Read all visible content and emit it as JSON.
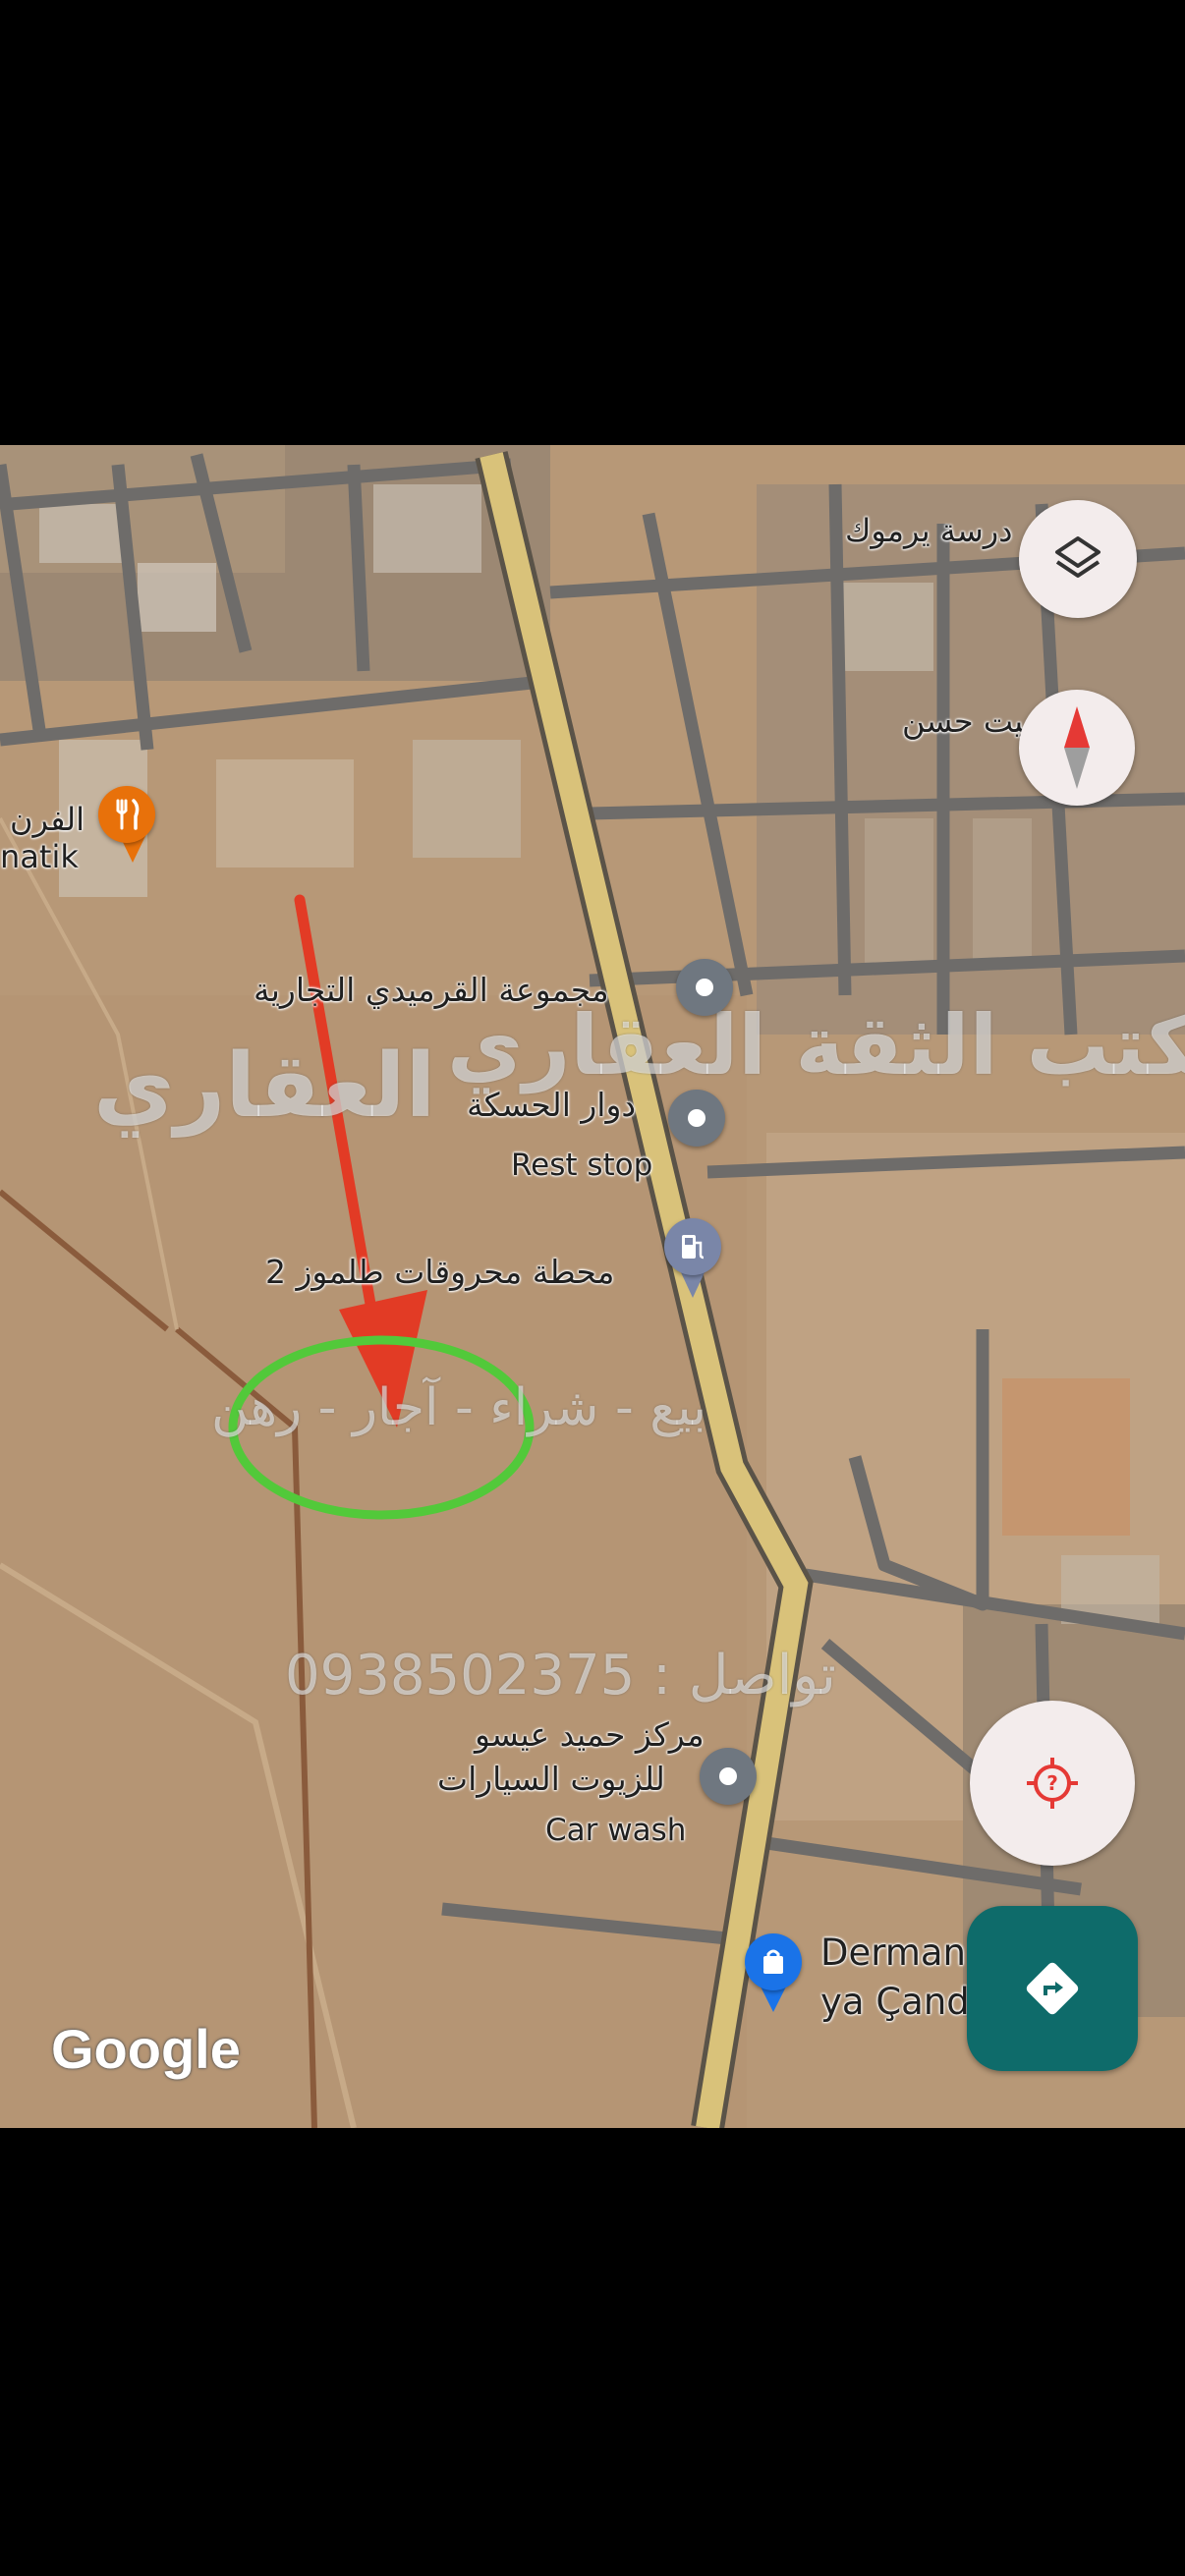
{
  "map": {
    "labels": {
      "school": "درسة يرموك",
      "hassan": "بيت حسن",
      "bakery_ar": "الفرن",
      "bakery_lat": "natik",
      "qarmidi": "مجموعة القرميدي التجارية",
      "hasaka_roundabout": "دوار الحسكة",
      "rest_stop": "Rest stop",
      "fuel_station": "محطة محروقات طلموز 2",
      "hamid_line1": "مركز حميد عيسو",
      "hamid_line2": "للزيوت السيارات",
      "car_wash": "Car wash",
      "pharmacy_line1": "Derman izîn",
      "pharmacy_line2": "ya Çand",
      "google_logo": "Google"
    },
    "watermark": {
      "office_name": "مكتب الثقة العقاري",
      "office_short": "العقاري",
      "services": "بيع - شراء - آجار - رهن",
      "contact": "تواصل : 0938502375"
    },
    "icons": {
      "restaurant": "restaurant-icon",
      "fuel": "gas-station-icon",
      "shop": "shopping-bag-icon",
      "place": "place-pin-icon",
      "layers": "layers-icon",
      "compass": "compass-icon",
      "location": "my-location-icon",
      "directions": "directions-icon"
    },
    "colors": {
      "arrow": "#e23b25",
      "circle": "#52c93a",
      "directions_button": "#0e6b6a",
      "restaurant_pin": "#e8710a",
      "fuel_pin": "#7a86a8",
      "shop_pin": "#1a73e8",
      "place_pin": "#6f7780"
    }
  }
}
